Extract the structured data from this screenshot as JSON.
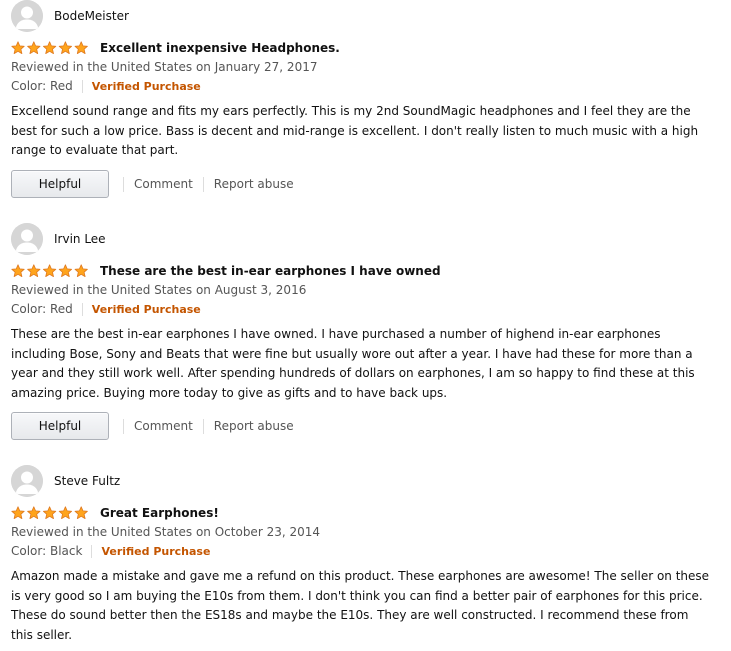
{
  "reviews": [
    {
      "profile_name": "BodeMeister",
      "rating": 5,
      "title": "Excellent inexpensive Headphones.",
      "date": "Reviewed in the United States on January 27, 2017",
      "color": "Color: Red",
      "verified": "Verified Purchase",
      "body": "Excellend sound range and fits my ears perfectly. This is my 2nd SoundMagic headphones and I feel they are the best for such a low price. Bass is decent and mid-range is excellent. I don't really listen to much music with a high range to evaluate that part.",
      "helpful_label": "Helpful",
      "comment_label": "Comment",
      "report_label": "Report abuse"
    },
    {
      "profile_name": "Irvin Lee",
      "rating": 5,
      "title": "These are the best in-ear earphones I have owned",
      "date": "Reviewed in the United States on August 3, 2016",
      "color": "Color: Red",
      "verified": "Verified Purchase",
      "body": "These are the best in-ear earphones I have owned. I have purchased a number of highend in-ear earphones including Bose, Sony and Beats that were fine but usually wore out after a year. I have had these for more than a year and they still work well. After spending hundreds of dollars on earphones, I am so happy to find these at this amazing price. Buying more today to give as gifts and to have back ups.",
      "helpful_label": "Helpful",
      "comment_label": "Comment",
      "report_label": "Report abuse"
    },
    {
      "profile_name": "Steve Fultz",
      "rating": 5,
      "title": "Great Earphones!",
      "date": "Reviewed in the United States on October 23, 2014",
      "color": "Color: Black",
      "verified": "Verified Purchase",
      "body": "Amazon made a mistake and gave me a refund on this product. These earphones are awesome! The seller on these is very good so I am buying the E10s from them. I don't think you can find a better pair of earphones for this price. These do sound better then the ES18s and maybe the E10s. They are well constructed. I recommend these from this seller."
    }
  ],
  "icons": {
    "avatar": "default-profile-avatar-icon",
    "star": "star-filled-icon"
  },
  "colors": {
    "star_fill": "#ffa41c",
    "star_stroke": "#de7921",
    "verified": "#c45500",
    "secondary_text": "#555555"
  }
}
